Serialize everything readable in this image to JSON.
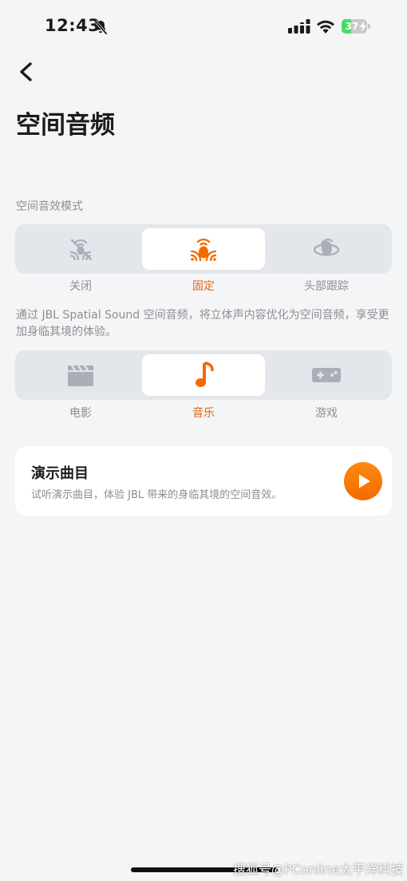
{
  "status_bar": {
    "time": "12:43",
    "battery_level": "37",
    "battery_fraction": 0.37,
    "icons": [
      "bell-slash-icon",
      "signal-icon",
      "wifi-icon",
      "battery-icon",
      "charging-bolt-icon"
    ]
  },
  "header": {
    "back_icon": "chevron-left-icon",
    "title": "空间音频"
  },
  "mode_section": {
    "label": "空间音效模式",
    "options": [
      {
        "label": "关闭",
        "icon": "spatial-off-icon",
        "selected": false
      },
      {
        "label": "固定",
        "icon": "spatial-fixed-icon",
        "selected": true
      },
      {
        "label": "头部跟踪",
        "icon": "head-tracking-icon",
        "selected": false
      }
    ],
    "description": "通过 JBL Spatial Sound 空间音频，将立体声内容优化为空间音频，享受更加身临其境的体验。"
  },
  "content_section": {
    "options": [
      {
        "label": "电影",
        "icon": "clapperboard-icon",
        "selected": false
      },
      {
        "label": "音乐",
        "icon": "music-note-icon",
        "selected": true
      },
      {
        "label": "游戏",
        "icon": "gamepad-icon",
        "selected": false
      }
    ]
  },
  "demo_card": {
    "title": "演示曲目",
    "subtitle": "试听演示曲目，体验 JBL 带来的身临其境的空间音效。",
    "play_icon": "play-icon"
  },
  "watermark": "搜狐号@PConline太平洋科技",
  "colors": {
    "accent": "#f26a00",
    "inactive_icon": "#a9afb8",
    "background": "#f4f5f6",
    "segment_bg": "#e3e6ea"
  }
}
